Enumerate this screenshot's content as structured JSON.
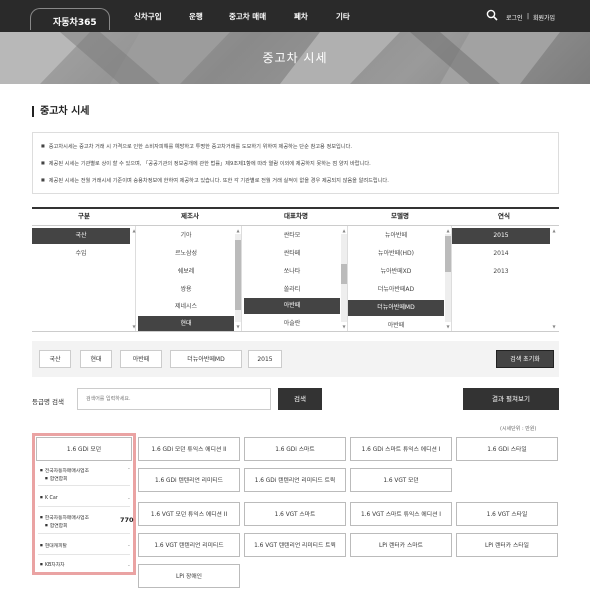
{
  "header": {
    "logo": "자동차365",
    "nav": [
      "신차구입",
      "운행",
      "중고차 매매",
      "폐차",
      "기타"
    ],
    "login": "로그인",
    "separator": "|",
    "signup": "회원가입",
    "search_icon": "search-icon"
  },
  "hero": {
    "title": "중고차 시세"
  },
  "section": {
    "title": "중고차 시세"
  },
  "notices": [
    "중고차시세는 중고차 거래 시 가격으로 인한 소비자피해를 예방하고 투명한 중고차거래를 도모하기 위하여 제공하는 단순 참고용 정보입니다.",
    "제공된 시세는 기관별로 상이 할 수 있으며, 「공공기관의 정보공개에 관한 법률」제9조제1항에 따라 열람 이외에 제공하지 못하는 점 양지 바랍니다.",
    "제공된 시세는 전월 거래시세 기준이며 승용차정보에 한하여 제공하고 있습니다. 또한 각 기관별로 전월 거래 실적이 없을 경우 제공되지 않음을 알려드립니다."
  ],
  "selector": {
    "headers": [
      "구분",
      "제조사",
      "대표차명",
      "모델명",
      "연식"
    ],
    "type": [
      "국산",
      "수입"
    ],
    "maker": [
      "기아",
      "르노삼성",
      "쉐보레",
      "쌍용",
      "제네시스",
      "현대"
    ],
    "car": [
      "싼타모",
      "싼타페",
      "쏘나타",
      "쏠라티",
      "아반떼",
      "아슬란"
    ],
    "model": [
      "뉴아반떼",
      "뉴아반떼(HD)",
      "뉴아반떼XD",
      "더뉴아반떼AD",
      "더뉴아반떼MD",
      "아반떼"
    ],
    "year": [
      "2015",
      "2014",
      "2013"
    ]
  },
  "chips": [
    "국산",
    "현대",
    "아반떼",
    "더뉴아반떼MD",
    "2015"
  ],
  "reset_label": "검색 초기화",
  "grade_search": {
    "label": "등급명 검색",
    "placeholder": "검색어를 입력하세요.",
    "search_label": "검색",
    "result_label": "결과 펼쳐보기"
  },
  "unit": "(시세단위 : 만원)",
  "grades": [
    "1.6 GDi 모던",
    "1.6 GDi 모던 튜익스 에디션 II",
    "1.6 GDi 스마트",
    "1.6 GDi 스마트 튜익스 에디션 I",
    "1.6 GDi 스타일",
    "1.6 GDi 텐텐리언 리미티드",
    "1.6 GDi 텐텐리언 리미티드 트윅",
    "1.6 VGT 모던",
    "1.6 VGT 모던 튜익스 에디션 II",
    "1.6 VGT 스마트",
    "1.6 VGT 스마트 튜익스 에디션 I",
    "1.6 VGT 스타일",
    "1.6 VGT 텐텐리언 리미티드",
    "1.6 VGT 텐텐리언 리미티드 트윅",
    "LPi 렌터카 스마트",
    "LPi 렌터카 스타일",
    "LPi 장애인"
  ],
  "dealers": [
    {
      "name": "전국자동차매매사업조\n합연합회",
      "price": "-"
    },
    {
      "name": "K Car",
      "price": "-"
    },
    {
      "name": "한국자동차매매사업조\n합연합회",
      "price": "770"
    },
    {
      "name": "현대캐피탈",
      "price": "-"
    },
    {
      "name": "KB차차차",
      "price": "-"
    }
  ]
}
